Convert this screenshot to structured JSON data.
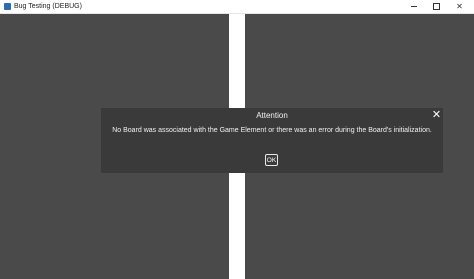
{
  "window": {
    "title": "Bug Testing (DEBUG)",
    "close_glyph": "✕"
  },
  "dialog": {
    "title": "Attention",
    "close_glyph": "✕",
    "message": "No Board was associated with the Game Element or there was an error during the Board's initialization.",
    "ok_label": "OK"
  },
  "colors": {
    "panel": "#4a4a4a",
    "dialog_bg": "#3a3a3a",
    "background": "#ffffff"
  }
}
